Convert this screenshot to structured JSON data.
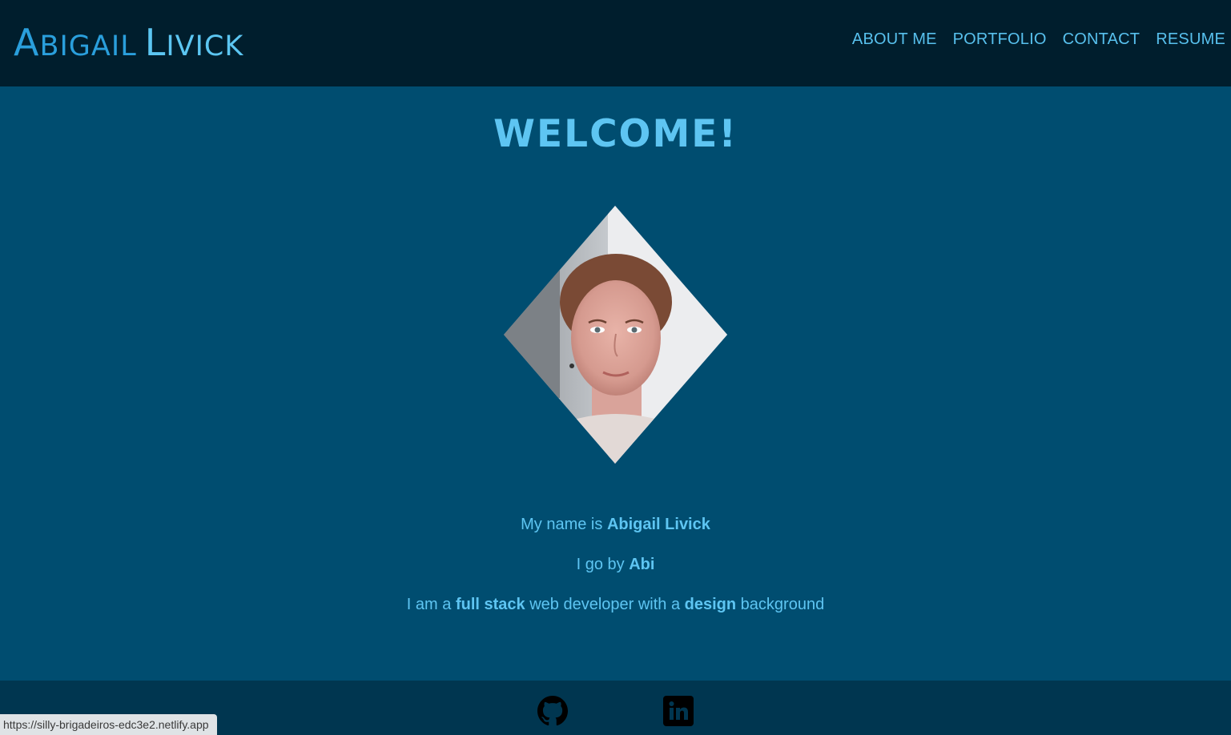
{
  "header": {
    "logo": {
      "first_cap": "A",
      "first_rest": "BIGAIL",
      "last_cap": "L",
      "last_rest": "IVICK"
    },
    "nav": [
      {
        "label": "ABOUT ME"
      },
      {
        "label": "PORTFOLIO"
      },
      {
        "label": "CONTACT"
      },
      {
        "label": "RESUME"
      }
    ]
  },
  "main": {
    "heading": "WELCOME!",
    "bio": {
      "line1_prefix": "My name is ",
      "line1_bold": "Abigail Livick",
      "line2_prefix": "I go by ",
      "line2_bold": "Abi",
      "line3_part1": "I am a ",
      "line3_bold1": "full stack",
      "line3_part2": " web developer with a ",
      "line3_bold2": "design",
      "line3_part3": " background"
    }
  },
  "footer": {
    "social": [
      {
        "icon": "github-icon"
      },
      {
        "icon": "linkedin-icon"
      }
    ]
  },
  "status_bar": {
    "url": "https://silly-brigadeiros-edc3e2.netlify.app"
  },
  "colors": {
    "header_bg": "#001e2d",
    "main_bg": "#004d70",
    "footer_bg": "#003650",
    "accent": "#5ec5f2",
    "logo_blue": "#2a9fdc"
  }
}
